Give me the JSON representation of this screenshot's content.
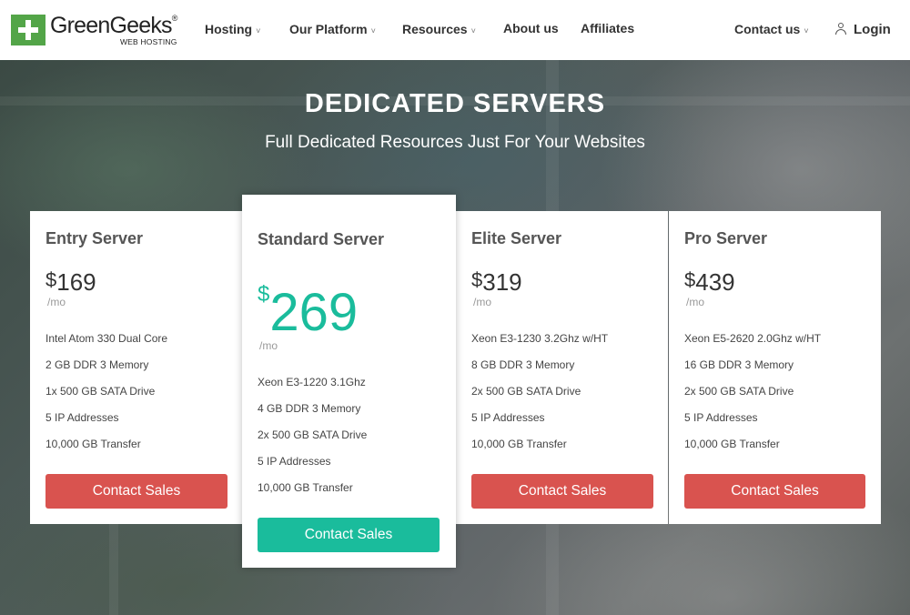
{
  "brand": {
    "name": "GreenGeeks",
    "reg": "®",
    "sub": "WEB HOSTING"
  },
  "nav": {
    "hosting": "Hosting",
    "platform": "Our Platform",
    "resources": "Resources",
    "about": "About us",
    "affiliates": "Affiliates",
    "contact": "Contact us",
    "login": "Login",
    "chevron": "˅"
  },
  "hero": {
    "title": "DEDICATED SERVERS",
    "subtitle": "Full Dedicated Resources Just For Your Websites"
  },
  "plans": [
    {
      "name": "Entry Server",
      "currency": "$",
      "price": "169",
      "period": "/mo",
      "features": [
        "Intel Atom 330 Dual Core",
        "2 GB DDR 3 Memory",
        "1x 500 GB SATA Drive",
        "5 IP Addresses",
        "10,000 GB Transfer"
      ],
      "cta": "Contact Sales"
    },
    {
      "name": "Standard Server",
      "currency": "$",
      "price": "269",
      "period": "/mo",
      "features": [
        "Xeon E3-1220 3.1Ghz",
        "4 GB DDR 3 Memory",
        "2x 500 GB SATA Drive",
        "5 IP Addresses",
        "10,000 GB Transfer"
      ],
      "cta": "Contact Sales"
    },
    {
      "name": "Elite Server",
      "currency": "$",
      "price": "319",
      "period": "/mo",
      "features": [
        "Xeon E3-1230 3.2Ghz w/HT",
        "8 GB DDR 3 Memory",
        "2x 500 GB SATA Drive",
        "5 IP Addresses",
        "10,000 GB Transfer"
      ],
      "cta": "Contact Sales"
    },
    {
      "name": "Pro Server",
      "currency": "$",
      "price": "439",
      "period": "/mo",
      "features": [
        "Xeon E5-2620 2.0Ghz w/HT",
        "16 GB DDR 3 Memory",
        "2x 500 GB SATA Drive",
        "5 IP Addresses",
        "10,000 GB Transfer"
      ],
      "cta": "Contact Sales"
    }
  ],
  "colors": {
    "brand_green": "#53a548",
    "accent_teal": "#1abc9c",
    "cta_red": "#d9534f"
  }
}
